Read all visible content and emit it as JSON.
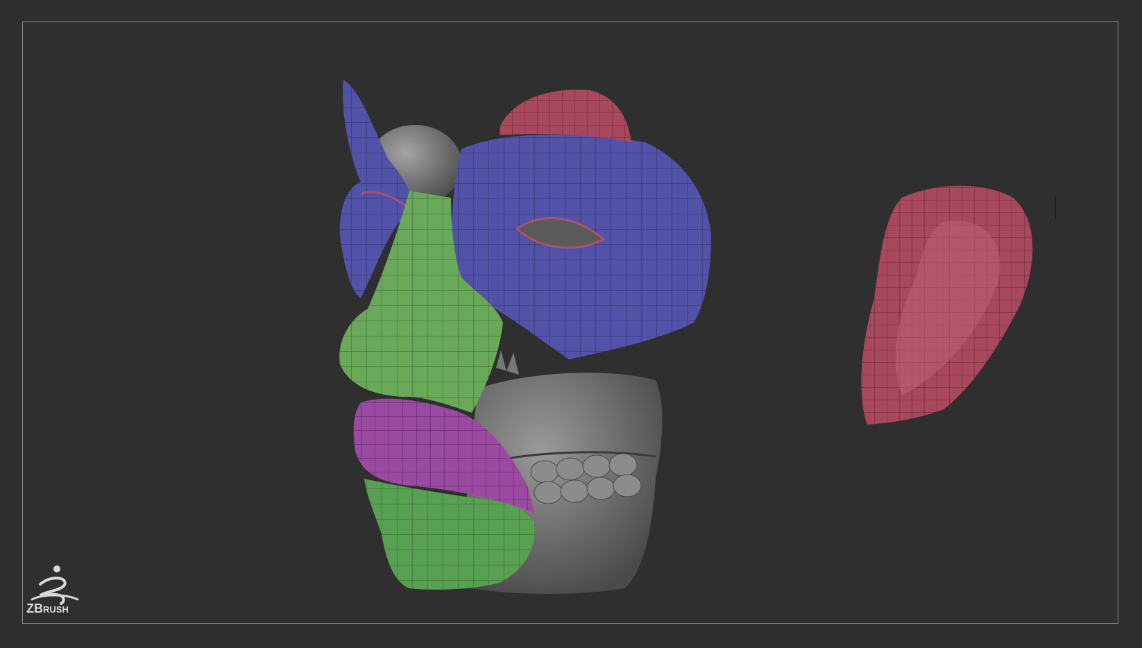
{
  "app": {
    "logo_text_big": "ZB",
    "logo_text_small": "RUSH",
    "logo_icon": "zbrush-runner-icon"
  },
  "viewport": {
    "background_color": "#2f2f2f",
    "frame_color": "#8a8a8a"
  },
  "polygroups": {
    "brow_eye": "#5252a8",
    "nose": "#6aa85a",
    "upper_lip": "#9a4aa0",
    "lower_lip": "#58a052",
    "ear": "#a8485e",
    "base_mesh": "#6c6c6c"
  }
}
